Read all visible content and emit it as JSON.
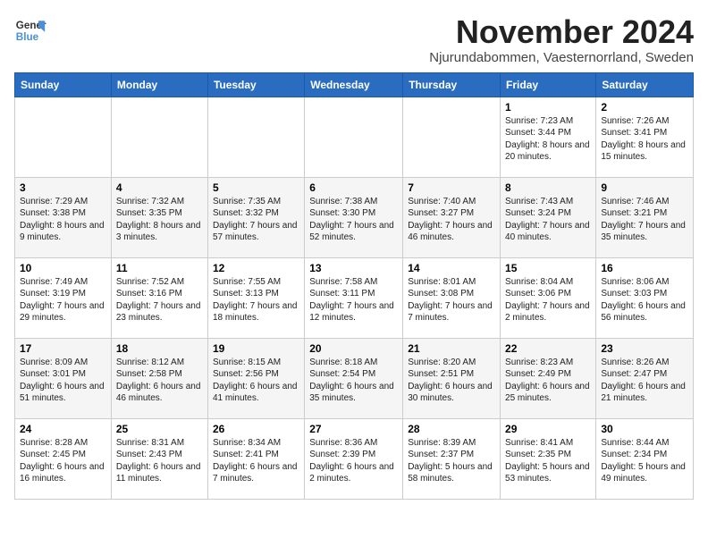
{
  "logo": {
    "line1": "General",
    "line2": "Blue"
  },
  "title": "November 2024",
  "subtitle": "Njurundabommen, Vaesternorrland, Sweden",
  "days": [
    "Sunday",
    "Monday",
    "Tuesday",
    "Wednesday",
    "Thursday",
    "Friday",
    "Saturday"
  ],
  "weeks": [
    [
      {
        "day": "",
        "text": ""
      },
      {
        "day": "",
        "text": ""
      },
      {
        "day": "",
        "text": ""
      },
      {
        "day": "",
        "text": ""
      },
      {
        "day": "",
        "text": ""
      },
      {
        "day": "1",
        "text": "Sunrise: 7:23 AM\nSunset: 3:44 PM\nDaylight: 8 hours and 20 minutes."
      },
      {
        "day": "2",
        "text": "Sunrise: 7:26 AM\nSunset: 3:41 PM\nDaylight: 8 hours and 15 minutes."
      }
    ],
    [
      {
        "day": "3",
        "text": "Sunrise: 7:29 AM\nSunset: 3:38 PM\nDaylight: 8 hours and 9 minutes."
      },
      {
        "day": "4",
        "text": "Sunrise: 7:32 AM\nSunset: 3:35 PM\nDaylight: 8 hours and 3 minutes."
      },
      {
        "day": "5",
        "text": "Sunrise: 7:35 AM\nSunset: 3:32 PM\nDaylight: 7 hours and 57 minutes."
      },
      {
        "day": "6",
        "text": "Sunrise: 7:38 AM\nSunset: 3:30 PM\nDaylight: 7 hours and 52 minutes."
      },
      {
        "day": "7",
        "text": "Sunrise: 7:40 AM\nSunset: 3:27 PM\nDaylight: 7 hours and 46 minutes."
      },
      {
        "day": "8",
        "text": "Sunrise: 7:43 AM\nSunset: 3:24 PM\nDaylight: 7 hours and 40 minutes."
      },
      {
        "day": "9",
        "text": "Sunrise: 7:46 AM\nSunset: 3:21 PM\nDaylight: 7 hours and 35 minutes."
      }
    ],
    [
      {
        "day": "10",
        "text": "Sunrise: 7:49 AM\nSunset: 3:19 PM\nDaylight: 7 hours and 29 minutes."
      },
      {
        "day": "11",
        "text": "Sunrise: 7:52 AM\nSunset: 3:16 PM\nDaylight: 7 hours and 23 minutes."
      },
      {
        "day": "12",
        "text": "Sunrise: 7:55 AM\nSunset: 3:13 PM\nDaylight: 7 hours and 18 minutes."
      },
      {
        "day": "13",
        "text": "Sunrise: 7:58 AM\nSunset: 3:11 PM\nDaylight: 7 hours and 12 minutes."
      },
      {
        "day": "14",
        "text": "Sunrise: 8:01 AM\nSunset: 3:08 PM\nDaylight: 7 hours and 7 minutes."
      },
      {
        "day": "15",
        "text": "Sunrise: 8:04 AM\nSunset: 3:06 PM\nDaylight: 7 hours and 2 minutes."
      },
      {
        "day": "16",
        "text": "Sunrise: 8:06 AM\nSunset: 3:03 PM\nDaylight: 6 hours and 56 minutes."
      }
    ],
    [
      {
        "day": "17",
        "text": "Sunrise: 8:09 AM\nSunset: 3:01 PM\nDaylight: 6 hours and 51 minutes."
      },
      {
        "day": "18",
        "text": "Sunrise: 8:12 AM\nSunset: 2:58 PM\nDaylight: 6 hours and 46 minutes."
      },
      {
        "day": "19",
        "text": "Sunrise: 8:15 AM\nSunset: 2:56 PM\nDaylight: 6 hours and 41 minutes."
      },
      {
        "day": "20",
        "text": "Sunrise: 8:18 AM\nSunset: 2:54 PM\nDaylight: 6 hours and 35 minutes."
      },
      {
        "day": "21",
        "text": "Sunrise: 8:20 AM\nSunset: 2:51 PM\nDaylight: 6 hours and 30 minutes."
      },
      {
        "day": "22",
        "text": "Sunrise: 8:23 AM\nSunset: 2:49 PM\nDaylight: 6 hours and 25 minutes."
      },
      {
        "day": "23",
        "text": "Sunrise: 8:26 AM\nSunset: 2:47 PM\nDaylight: 6 hours and 21 minutes."
      }
    ],
    [
      {
        "day": "24",
        "text": "Sunrise: 8:28 AM\nSunset: 2:45 PM\nDaylight: 6 hours and 16 minutes."
      },
      {
        "day": "25",
        "text": "Sunrise: 8:31 AM\nSunset: 2:43 PM\nDaylight: 6 hours and 11 minutes."
      },
      {
        "day": "26",
        "text": "Sunrise: 8:34 AM\nSunset: 2:41 PM\nDaylight: 6 hours and 7 minutes."
      },
      {
        "day": "27",
        "text": "Sunrise: 8:36 AM\nSunset: 2:39 PM\nDaylight: 6 hours and 2 minutes."
      },
      {
        "day": "28",
        "text": "Sunrise: 8:39 AM\nSunset: 2:37 PM\nDaylight: 5 hours and 58 minutes."
      },
      {
        "day": "29",
        "text": "Sunrise: 8:41 AM\nSunset: 2:35 PM\nDaylight: 5 hours and 53 minutes."
      },
      {
        "day": "30",
        "text": "Sunrise: 8:44 AM\nSunset: 2:34 PM\nDaylight: 5 hours and 49 minutes."
      }
    ]
  ]
}
